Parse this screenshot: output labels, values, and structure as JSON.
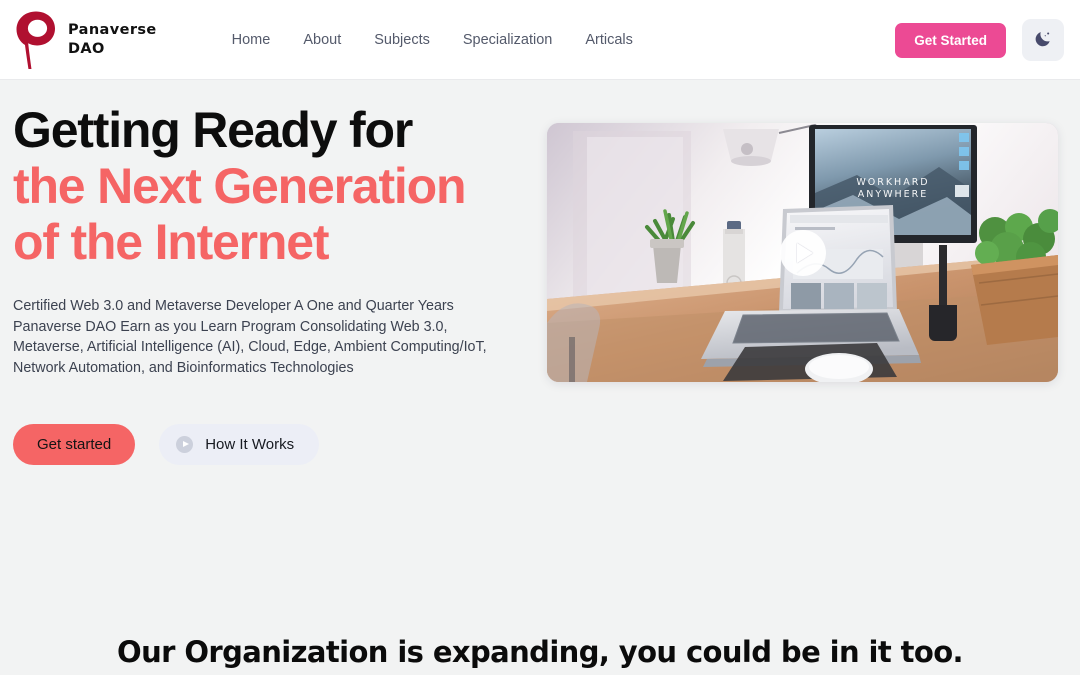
{
  "brand": {
    "name": "Panaverse\nDAO",
    "logo_icon": "panaverse-pin-logo",
    "logo_color": "#b01030"
  },
  "nav": {
    "links": [
      {
        "label": "Home"
      },
      {
        "label": "About"
      },
      {
        "label": "Subjects"
      },
      {
        "label": "Specialization"
      },
      {
        "label": "Articals"
      }
    ],
    "get_started_label": "Get Started",
    "get_started_color": "#ec4a94",
    "theme_toggle_icon": "moon-icon"
  },
  "hero": {
    "title_line1": "Getting Ready for",
    "title_line2": "the Next Generation",
    "title_line3": "of the Internet",
    "accent_color": "#f56565",
    "description": "Certified Web 3.0 and Metaverse Developer A One and Quarter Years Panaverse DAO Earn as you Learn Program Consolidating Web 3.0, Metaverse, Artificial Intelligence (AI), Cloud, Edge, Ambient Computing/IoT, Network Automation, and Bioinformatics Technologies",
    "primary_cta": "Get started",
    "secondary_cta": "How It Works",
    "secondary_cta_icon": "play-circle-icon",
    "video": {
      "play_icon": "play-button-icon",
      "monitor_text_line1": "WORKHARD",
      "monitor_text_line2": "ANYWHERE",
      "alt": "Desk workspace with laptop, monitor, plants and water bottle"
    }
  },
  "organization": {
    "heading": "Our Organization is expanding, you could be in it too."
  }
}
